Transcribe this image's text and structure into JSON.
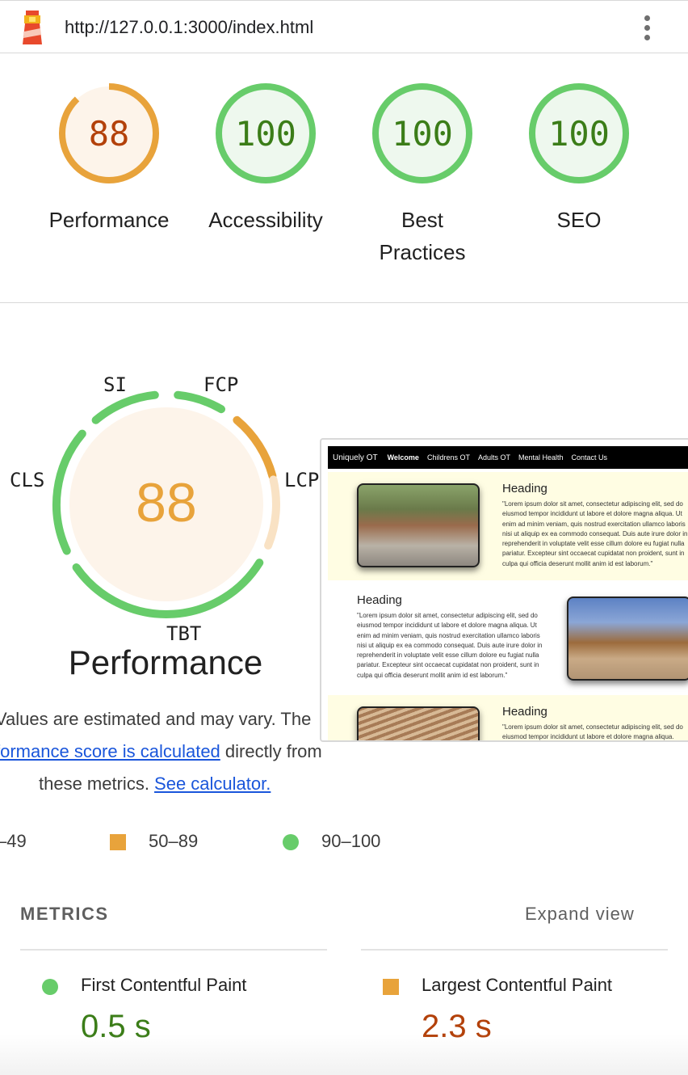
{
  "topbar": {
    "url": "http://127.0.0.1:3000/index.html",
    "menu_icon": "kebab-menu-icon",
    "logo_icon": "lighthouse-icon"
  },
  "gauges": [
    {
      "score": "88",
      "label": "Performance",
      "status": "average"
    },
    {
      "score": "100",
      "label": "Accessibility",
      "status": "pass"
    },
    {
      "score": "100",
      "label": "Best Practices",
      "status": "pass"
    },
    {
      "score": "100",
      "label": "SEO",
      "status": "pass"
    }
  ],
  "colors": {
    "pass": "#67cc6a",
    "pass_text": "#3b7d18",
    "average": "#e8a33b",
    "average_text": "#b3410a",
    "pass_bg": "#eef8ee",
    "average_bg": "#fdf4ea",
    "link": "#1a56db"
  },
  "performance_detail": {
    "score": "88",
    "title": "Performance",
    "metric_tags": {
      "si": "SI",
      "fcp": "FCP",
      "lcp": "LCP",
      "tbt": "TBT",
      "cls": "CLS"
    },
    "desc_line1": "Values are estimated and may vary. The",
    "desc_link": "formance score is calculated",
    "desc_line2_rest": " directly from",
    "desc_line3": "these metrics. ",
    "desc_calc_link": "See calculator."
  },
  "thumbnail": {
    "nav": {
      "brand": "Uniquely OT",
      "items": [
        "Welcome",
        "Childrens OT",
        "Adults OT",
        "Mental Health",
        "Contact Us"
      ],
      "active": "Welcome"
    },
    "sections": [
      {
        "heading": "Heading",
        "text": "\"Lorem ipsum dolor sit amet, consectetur adipiscing elit, sed do eiusmod tempor incididunt ut labore et dolore magna aliqua. Ut enim ad minim veniam, quis nostrud exercitation ullamco laboris nisi ut aliquip ex ea commodo consequat. Duis aute irure dolor in reprehenderit in voluptate velit esse cillum dolore eu fugiat nulla pariatur. Excepteur sint occaecat cupidatat non proident, sunt in culpa qui officia deserunt mollit anim id est laborum.\""
      },
      {
        "heading": "Heading",
        "text": "\"Lorem ipsum dolor sit amet, consectetur adipiscing elit, sed do eiusmod tempor incididunt ut labore et dolore magna aliqua. Ut enim ad minim veniam, quis nostrud exercitation ullamco laboris nisi ut aliquip ex ea commodo consequat. Duis aute irure dolor in reprehenderit in voluptate velit esse cillum dolore eu fugiat nulla pariatur. Excepteur sint occaecat cupidatat non proident, sunt in culpa qui officia deserunt mollit anim id est laborum.\""
      },
      {
        "heading": "Heading",
        "text": "\"Lorem ipsum dolor sit amet, consectetur adipiscing elit, sed do eiusmod tempor incididunt ut labore et dolore magna aliqua."
      }
    ]
  },
  "legend": {
    "fail": "–49",
    "average": "50–89",
    "pass": "90–100"
  },
  "metrics": {
    "heading": "METRICS",
    "expand": "Expand view",
    "items": [
      {
        "label": "First Contentful Paint",
        "value": "0.5 s",
        "status": "pass"
      },
      {
        "label": "Largest Contentful Paint",
        "value": "2.3 s",
        "status": "average"
      }
    ]
  }
}
